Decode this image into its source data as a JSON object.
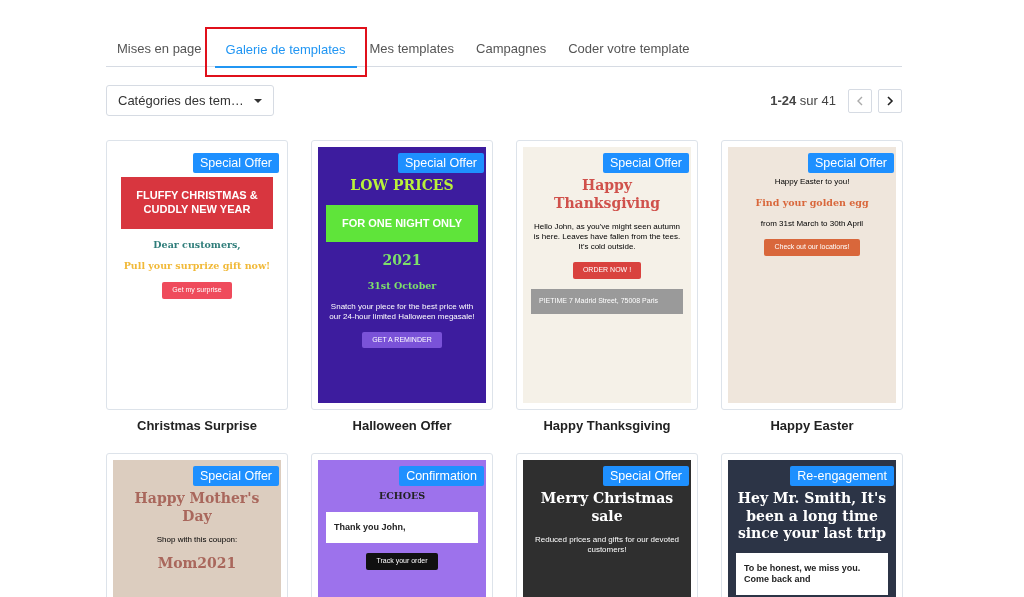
{
  "tabs": [
    {
      "label": "Mises en page",
      "selected": false,
      "highlighted": false
    },
    {
      "label": "Galerie de templates",
      "selected": true,
      "highlighted": true
    },
    {
      "label": "Mes templates",
      "selected": false,
      "highlighted": false
    },
    {
      "label": "Campagnes",
      "selected": false,
      "highlighted": false
    },
    {
      "label": "Coder votre template",
      "selected": false,
      "highlighted": false
    }
  ],
  "category_dropdown": {
    "label": "Catégories des tem…"
  },
  "pagination": {
    "range": "**1-24** sur 41",
    "prev": {
      "disabled": true
    },
    "next": {
      "disabled": false
    }
  },
  "templates": [
    {
      "badge": "Special Offer",
      "name": "Christmas Surprise",
      "preview": {
        "color": "#ffffff",
        "lines": [
          {
            "kind": "banner",
            "text": "FLUFFY CHRISTMAS & CUDDLY NEW YEAR",
            "color": "#d8363f"
          },
          {
            "kind": "title",
            "text": "Dear customers,",
            "color": "#2f7d7a"
          },
          {
            "kind": "title",
            "text": "Pull your surprize gift now!",
            "color": "#f1b938"
          },
          {
            "kind": "button",
            "text": "Get my surprise",
            "color": "#ef4b5c"
          }
        ]
      }
    },
    {
      "badge": "Special Offer",
      "name": "Halloween Offer",
      "preview": {
        "color": "#3d1c9e",
        "dark": true,
        "lines": [
          {
            "kind": "headline",
            "text": "LOW PRICES",
            "color": "#b9f23a"
          },
          {
            "kind": "banner",
            "text": "FOR ONE NIGHT ONLY",
            "color": "#5fe43a"
          },
          {
            "kind": "headline",
            "text": "2021",
            "color": "#7ee06a"
          },
          {
            "kind": "title",
            "text": "31st October",
            "color": "#7ee06a"
          },
          {
            "kind": "body",
            "text": "Snatch your piece for the best price with our 24-hour limited Halloween megasale!"
          },
          {
            "kind": "button",
            "text": "GET A REMINDER",
            "color": "#7a52d8"
          }
        ]
      }
    },
    {
      "badge": "Special Offer",
      "name": "Happy Thanksgiving",
      "preview": {
        "color": "#f5f1e8",
        "dark": false,
        "lines": [
          {
            "kind": "headline",
            "text": "Happy Thanksgiving",
            "color": "#d0514b"
          },
          {
            "kind": "body",
            "text": "Hello John, as you've might seen autumn is here. Leaves have fallen from the tees. It's cold outside."
          },
          {
            "kind": "button",
            "text": "ORDER NOW !",
            "color": "#d9423e"
          },
          {
            "kind": "footer",
            "text": "PIETIME 7 Madrid Street, 75008 Paris",
            "color": "#9a9a9a"
          }
        ]
      }
    },
    {
      "badge": "Special Offer",
      "name": "Happy Easter",
      "preview": {
        "color": "#efe6dc",
        "dark": false,
        "lines": [
          {
            "kind": "body",
            "text": "Happy Easter to you!"
          },
          {
            "kind": "title",
            "text": "Find your golden egg",
            "color": "#d9673b"
          },
          {
            "kind": "body",
            "text": "from 31st March to 30th April"
          },
          {
            "kind": "button",
            "text": "Check out our locations!",
            "color": "#d9673b"
          }
        ]
      }
    },
    {
      "badge": "Special Offer",
      "preview": {
        "color": "#dccdbf",
        "dark": false,
        "lines": [
          {
            "kind": "headline",
            "text": "Happy Mother's Day",
            "color": "#a9675c"
          },
          {
            "kind": "body",
            "text": "Shop with this coupon:"
          },
          {
            "kind": "headline",
            "text": "Mom2021",
            "color": "#a9675c"
          }
        ]
      }
    },
    {
      "badge": "Confirmation",
      "preview": {
        "color": "#9d72ec",
        "lines": [
          {
            "kind": "title",
            "text": "ECHOES",
            "color": "#222222"
          },
          {
            "kind": "card",
            "text": "Thank you John,",
            "color": "#ffffff"
          },
          {
            "kind": "button",
            "text": "Track your order",
            "color": "#111111"
          }
        ]
      }
    },
    {
      "badge": "Special Offer",
      "preview": {
        "color": "#2f2f2f",
        "dark": true,
        "lines": [
          {
            "kind": "headline",
            "text": "Merry Christmas sale",
            "color": "#ffffff"
          },
          {
            "kind": "body",
            "text": "Reduced prices and gifts for our devoted customers!"
          }
        ]
      }
    },
    {
      "badge": "Re-engagement",
      "preview": {
        "color": "#2c3446",
        "lines": [
          {
            "kind": "headline",
            "text": "Hey Mr. Smith, It's been a long time since your last trip",
            "color": "#ffffff"
          },
          {
            "kind": "card",
            "text": "To be honest, we miss you. Come back and",
            "color": "#ffffff"
          }
        ]
      }
    }
  ]
}
